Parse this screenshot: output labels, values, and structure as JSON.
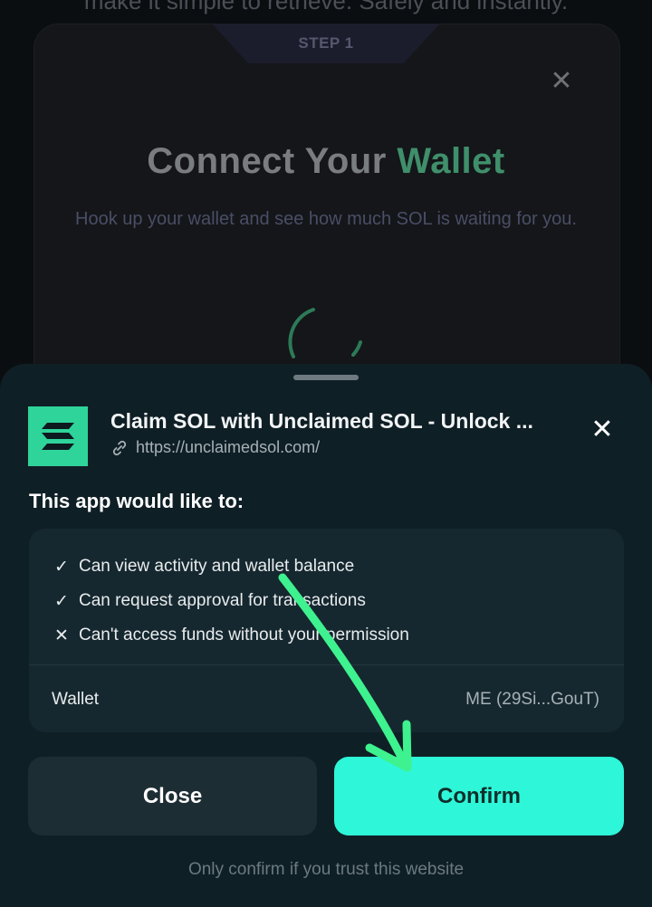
{
  "background": {
    "top_text": "make it simple to retrieve. Safely and instantly.",
    "step_label": "STEP 1",
    "title_main": "Connect Your",
    "title_accent": "Wallet",
    "subtitle": "Hook up your wallet and see how much SOL is waiting for you.",
    "close_glyph": "✕",
    "colors": {
      "accent": "#3f8f6b",
      "spinner": "#3f8f6b"
    }
  },
  "sheet": {
    "app_icon": "solana-logo-icon",
    "app_title": "Claim SOL with Unclaimed SOL - Unlock ...",
    "app_url": "https://unclaimedsol.com/",
    "close_glyph": "✕",
    "permissions_heading": "This app would like to:",
    "permissions": [
      {
        "mark": "✓",
        "text": "Can view activity and wallet balance"
      },
      {
        "mark": "✓",
        "text": "Can request approval for transactions"
      },
      {
        "mark": "✕",
        "text": "Can't access funds without your permission"
      }
    ],
    "wallet_label": "Wallet",
    "wallet_value": "ME (29Si...GouT)",
    "close_button": "Close",
    "confirm_button": "Confirm",
    "footer_note": "Only confirm if you trust this website",
    "colors": {
      "confirm_bg": "#2ef6d8",
      "logo_bg": "#2fd49a",
      "annotation_arrow": "#3ef28f"
    }
  }
}
